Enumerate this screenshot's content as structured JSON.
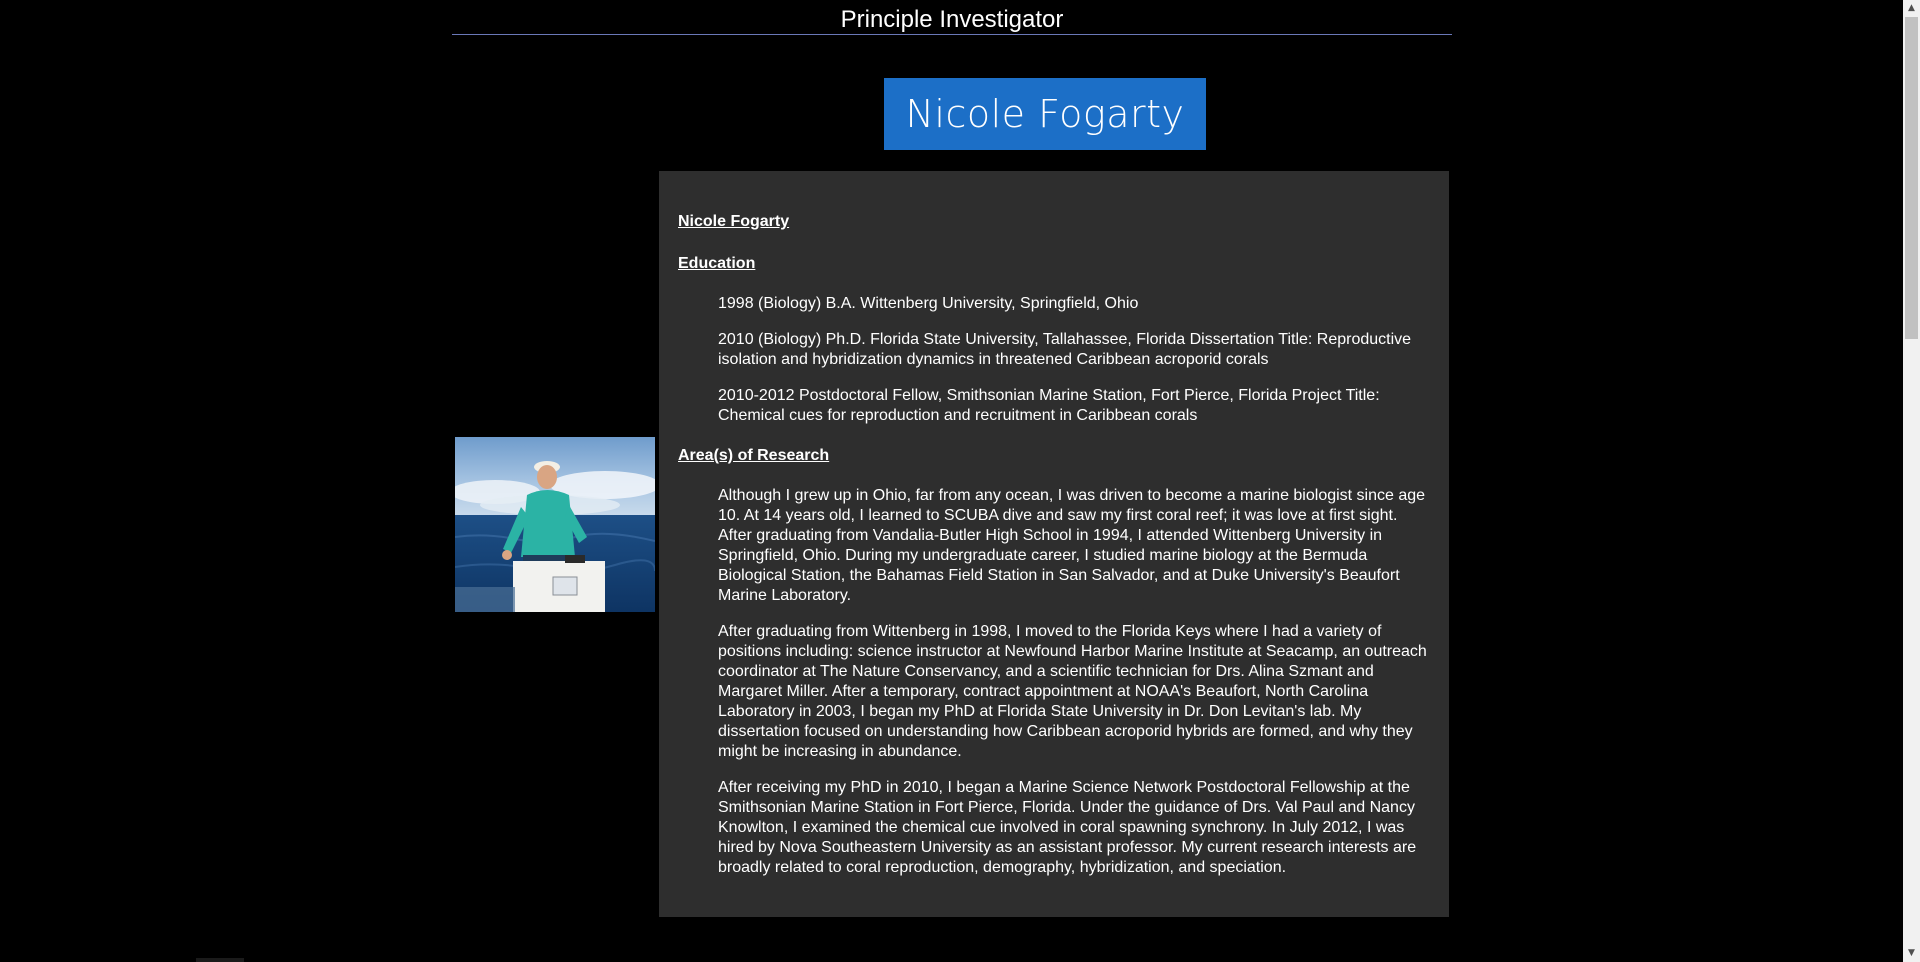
{
  "header": {
    "title": "Principle Investigator"
  },
  "banner": {
    "name": "Nicole Fogarty"
  },
  "photo": {
    "icon": "portrait-photo"
  },
  "bio": {
    "name_heading": "Nicole Fogarty",
    "education_heading": "Education",
    "education": [
      "1998 (Biology) B.A. Wittenberg University, Springfield, Ohio",
      "2010 (Biology) Ph.D. Florida State University, Tallahassee, Florida Dissertation Title: Reproductive isolation and hybridization dynamics in threatened Caribbean acroporid corals",
      "2010-2012 Postdoctoral Fellow, Smithsonian Marine Station, Fort Pierce, Florida Project Title: Chemical cues for reproduction and recruitment in Caribbean corals"
    ],
    "research_heading": "Area(s) of Research",
    "research": [
      "Although I grew up in Ohio, far from any ocean, I was driven to become a marine biologist since age 10. At 14 years old, I learned to SCUBA dive and saw my first coral reef; it was love at first sight. After graduating from Vandalia-Butler High School in 1994, I attended Wittenberg University in Springfield, Ohio. During my undergraduate career, I studied marine biology at the Bermuda Biological Station, the Bahamas Field Station in San Salvador, and at Duke University's Beaufort Marine Laboratory.",
      "After graduating from Wittenberg in 1998, I moved to the Florida Keys where I had a variety of positions including: science instructor at Newfound Harbor Marine Institute at Seacamp, an outreach coordinator at The Nature Conservancy, and a scientific technician for Drs. Alina Szmant and Margaret Miller. After a temporary, contract appointment at NOAA's Beaufort, North Carolina Laboratory in 2003, I began my PhD at Florida State University in Dr. Don Levitan's lab. My dissertation focused on understanding how Caribbean acroporid hybrids are formed, and why they might be increasing in abundance.",
      "After receiving my PhD in 2010, I began a Marine Science Network Postdoctoral Fellowship at the Smithsonian Marine Station in Fort Pierce, Florida. Under the guidance of Drs. Val Paul and Nancy Knowlton, I examined the chemical cue involved in coral spawning synchrony. In July 2012, I was hired by Nova Southeastern University as an assistant professor. My current research interests are broadly related to coral reproduction, demography, hybridization, and speciation."
    ]
  },
  "scrollbar": {
    "up_icon": "▲",
    "down_icon": "▼"
  },
  "colors": {
    "background": "#000000",
    "banner": "#1c6fc7",
    "panel": "#2e2e2e",
    "header_rule": "#6a78b8"
  }
}
